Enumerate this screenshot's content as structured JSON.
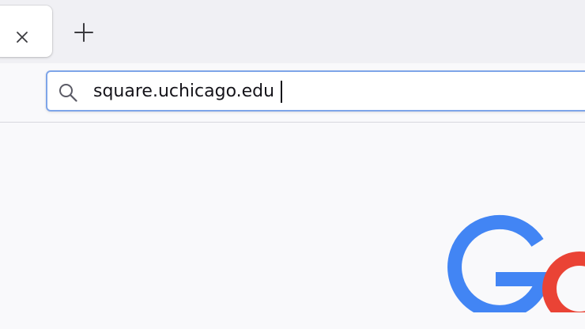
{
  "browser": {
    "tab": {
      "close_icon": "close-icon"
    },
    "new_tab_icon": "plus-icon",
    "urlbar": {
      "search_icon": "search-icon",
      "value": "square.uchicago.edu"
    }
  },
  "page": {
    "logo_name": "google-logo",
    "colors": {
      "blue": "#4285f4",
      "red": "#ea4335",
      "focus_ring": "#7ea5e9"
    }
  }
}
